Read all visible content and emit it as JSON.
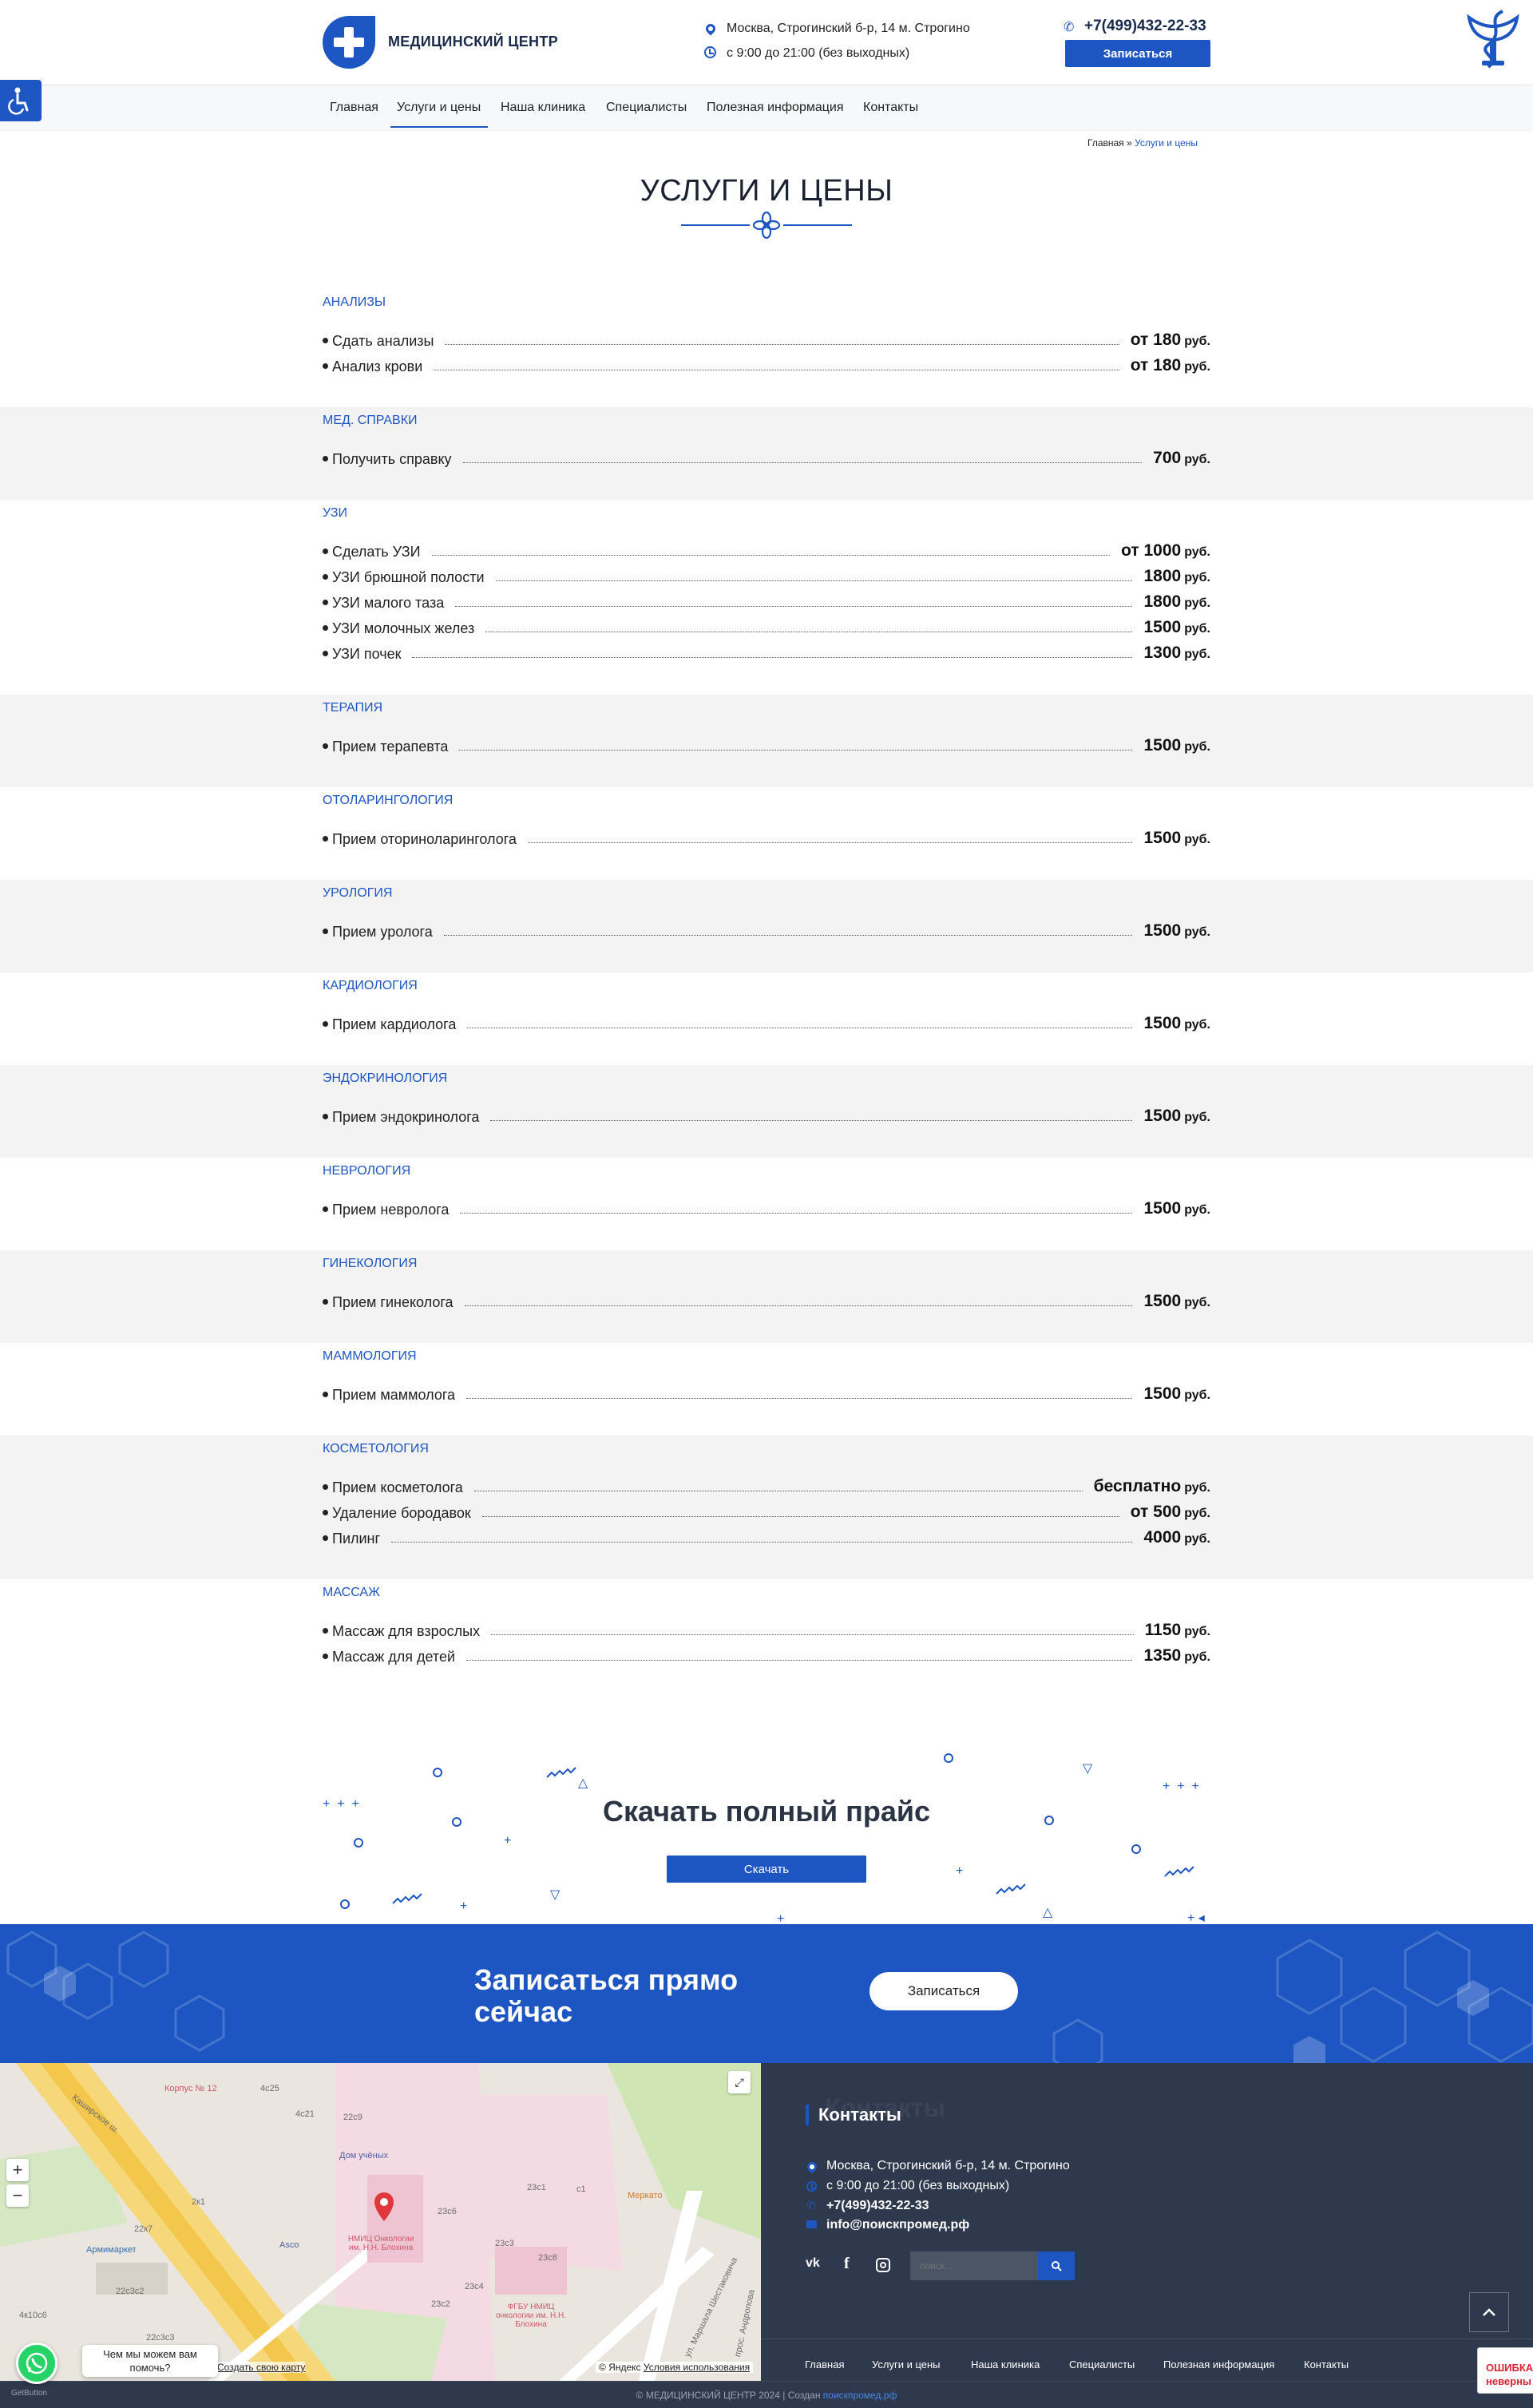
{
  "header": {
    "logo_text": "МЕДИЦИНСКИЙ ЦЕНТР",
    "address": "Москва, Строгинский б-р, 14 м. Строгино",
    "hours": "с 9:00 до 21:00 (без выходных)",
    "phone": "+7(499)432-22-33",
    "book_label": "Записаться"
  },
  "nav": {
    "items": [
      "Главная",
      "Услуги и цены",
      "Наша клиника",
      "Специалисты",
      "Полезная информация",
      "Контакты"
    ],
    "active": "Услуги и цены"
  },
  "breadcrumb": {
    "home": "Главная",
    "sep": "»",
    "current": "Услуги и цены"
  },
  "page_title": "УСЛУГИ И ЦЕНЫ",
  "currency": "руб.",
  "categories": [
    {
      "title": "АНАЛИЗЫ",
      "items": [
        {
          "name": "Сдать анализы",
          "price": "от 180"
        },
        {
          "name": "Анализ крови",
          "price": "от 180"
        }
      ]
    },
    {
      "title": "МЕД. СПРАВКИ",
      "items": [
        {
          "name": "Получить справку",
          "price": "700"
        }
      ]
    },
    {
      "title": "УЗИ",
      "items": [
        {
          "name": "Сделать УЗИ",
          "price": "от 1000"
        },
        {
          "name": "УЗИ брюшной полости",
          "price": "1800"
        },
        {
          "name": "УЗИ малого таза",
          "price": "1800"
        },
        {
          "name": "УЗИ молочных желез",
          "price": "1500"
        },
        {
          "name": "УЗИ почек",
          "price": "1300"
        }
      ]
    },
    {
      "title": "ТЕРАПИЯ",
      "items": [
        {
          "name": "Прием терапевта",
          "price": "1500"
        }
      ]
    },
    {
      "title": "ОТОЛАРИНГОЛОГИЯ",
      "items": [
        {
          "name": "Прием оториноларинголога",
          "price": "1500"
        }
      ]
    },
    {
      "title": "УРОЛОГИЯ",
      "items": [
        {
          "name": "Прием уролога",
          "price": "1500"
        }
      ]
    },
    {
      "title": "КАРДИОЛОГИЯ",
      "items": [
        {
          "name": "Прием кардиолога",
          "price": "1500"
        }
      ]
    },
    {
      "title": "ЭНДОКРИНОЛОГИЯ",
      "items": [
        {
          "name": "Прием эндокринолога",
          "price": "1500"
        }
      ]
    },
    {
      "title": "НЕВРОЛОГИЯ",
      "items": [
        {
          "name": "Прием невролога",
          "price": "1500"
        }
      ]
    },
    {
      "title": "ГИНЕКОЛОГИЯ",
      "items": [
        {
          "name": "Прием гинеколога",
          "price": "1500"
        }
      ]
    },
    {
      "title": "МАММОЛОГИЯ",
      "items": [
        {
          "name": "Прием маммолога",
          "price": "1500"
        }
      ]
    },
    {
      "title": "КОСМЕТОЛОГИЯ",
      "items": [
        {
          "name": "Прием косметолога",
          "price": "бесплатно"
        },
        {
          "name": "Удаление бородавок",
          "price": "от 500"
        },
        {
          "name": "Пилинг",
          "price": "4000"
        }
      ]
    },
    {
      "title": "МАССАЖ",
      "items": [
        {
          "name": "Массаж для взрослых",
          "price": "1150"
        },
        {
          "name": "Массаж для детей",
          "price": "1350"
        }
      ]
    }
  ],
  "download": {
    "title": "Скачать полный прайс",
    "button": "Скачать"
  },
  "cta": {
    "title": "Записаться прямо сейчас",
    "button": "Записаться"
  },
  "map": {
    "labels": [
      "Корпус № 12",
      "Каширское ш.",
      "Дом учёных",
      "НМИЦ Онкологии им. Н.Н. Блохина",
      "Армимаркет",
      "Asco",
      "Меркато",
      "ФГБУ НМИЦ онкологии им. Н.Н. Блохина",
      "ул. Маршала Шестаковича",
      "прос. Андропова",
      "4с25",
      "22с9",
      "4с21",
      "23с1",
      "23с6",
      "23с8",
      "23с4",
      "23с2",
      "23с3",
      "22с3с2",
      "22с3с3",
      "4к10с6",
      "2к1",
      "с1",
      "22к7"
    ],
    "create_link": "Создать свою карту",
    "credits": "© Яндекс",
    "terms": "Условия использования"
  },
  "contacts": {
    "ghost": "Контакты",
    "title": "Контакты",
    "address": "Москва, Строгинский б-р, 14 м. Строгино",
    "hours": "с 9:00 до 21:00 (без выходных)",
    "phone": "+7(499)432-22-33",
    "email": "info@поискпромед.рф",
    "search_placeholder": "поиск..."
  },
  "footer_nav": [
    "Главная",
    "Услуги и цены",
    "Наша клиника",
    "Специалисты",
    "Полезная информация",
    "Контакты"
  ],
  "copyright": {
    "text": "© МЕДИЦИНСКИЙ ЦЕНТР 2024 | Создан",
    "link": "поискпромед.рф"
  },
  "widgets": {
    "chat_text": "Чем мы можем вам помочь?",
    "getbutton": "GetButton",
    "error_badge": "ОШИБКА неверны"
  },
  "colors": {
    "brand": "#1d56c2",
    "dark": "#2f394d",
    "alt_row": "#f3f3f3",
    "whatsapp": "#25d366"
  }
}
